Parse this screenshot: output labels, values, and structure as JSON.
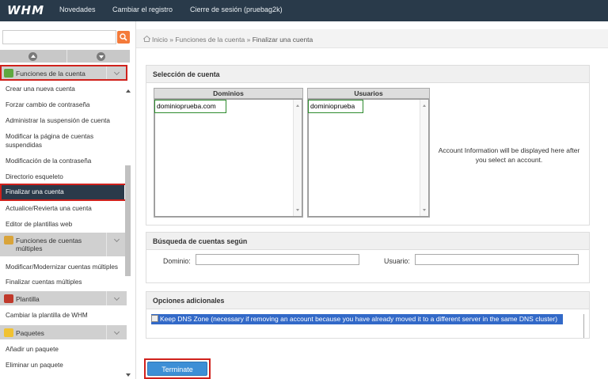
{
  "topbar": {
    "logo": "WHM",
    "nav": [
      "Novedades",
      "Cambiar el registro",
      "Cierre de sesión (pruebag2k)"
    ]
  },
  "sidebar": {
    "search": {
      "value": "",
      "placeholder": ""
    },
    "sections": [
      {
        "header": "Funciones de la cuenta",
        "icon": "accounts-icon",
        "items": [
          "Crear una nueva cuenta",
          "Forzar cambio de contraseña",
          "Administrar la suspensión de cuenta",
          "Modificar la página de cuentas suspendidas",
          "Modificación de la contraseña",
          "Directorio esqueleto",
          "Finalizar una cuenta",
          "Actualice/Revierta una cuenta",
          "Editor de plantillas web"
        ]
      },
      {
        "header": "Funciones de cuentas múltiples",
        "icon": "multi-accounts-icon",
        "items": [
          "Modificar/Modernizar cuentas múltiples",
          "Finalizar cuentas múltiples"
        ]
      },
      {
        "header": "Plantilla",
        "icon": "template-icon",
        "items": [
          "Cambiar la plantilla de WHM"
        ]
      },
      {
        "header": "Paquetes",
        "icon": "packages-icon",
        "items": [
          "Añadir un paquete",
          "Eliminar un paquete"
        ]
      }
    ]
  },
  "breadcrumb": {
    "home": "Inicio",
    "sep": "»",
    "section": "Funciones de la cuenta",
    "current": "Finalizar una cuenta"
  },
  "main": {
    "selection": {
      "title": "Selección de cuenta",
      "domains_header": "Dominios",
      "users_header": "Usuarios",
      "domain_value": "dominioprueba.com",
      "user_value": "dominioprueba",
      "info": "Account Information will be displayed here after you select an account."
    },
    "search": {
      "title": "Búsqueda de cuentas según",
      "domain_label": "Dominio:",
      "user_label": "Usuario:",
      "domain_value": "",
      "user_value": ""
    },
    "options": {
      "title": "Opciones adicionales",
      "keep_dns": "Keep DNS Zone (necessary if removing an account because you have already moved it to a different server in the same DNS cluster)"
    },
    "terminate_label": "Terminate"
  },
  "colors": {
    "topbar": "#293a4a",
    "active_item": "#2b3a4a",
    "highlight_red": "#d0211c",
    "highlight_green": "#2e8b2e",
    "button_blue": "#3d8fd6",
    "search_button": "#f47a3a"
  }
}
